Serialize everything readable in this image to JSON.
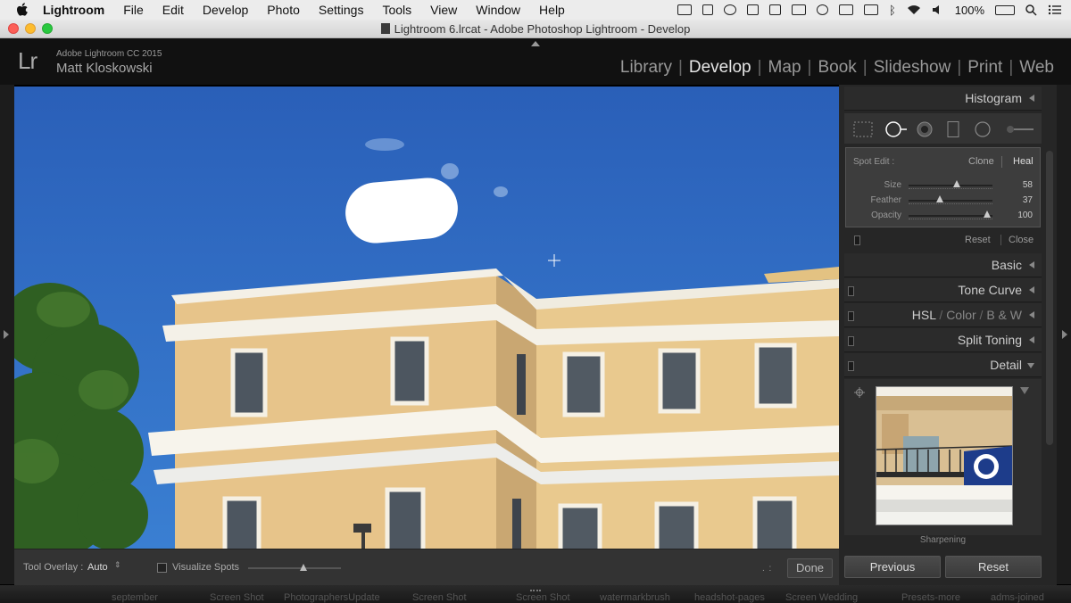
{
  "menubar": {
    "app": "Lightroom",
    "items": [
      "File",
      "Edit",
      "Develop",
      "Photo",
      "Settings",
      "Tools",
      "View",
      "Window",
      "Help"
    ],
    "battery": "100%"
  },
  "window": {
    "title": "Lightroom 6.lrcat - Adobe Photoshop Lightroom - Develop"
  },
  "identity": {
    "logo": "Lr",
    "product": "Adobe Lightroom CC 2015",
    "user": "Matt Kloskowski"
  },
  "modules": [
    "Library",
    "Develop",
    "Map",
    "Book",
    "Slideshow",
    "Print",
    "Web"
  ],
  "active_module": "Develop",
  "toolbar": {
    "overlay_label": "Tool Overlay :",
    "overlay_value": "Auto",
    "visualize_label": "Visualize Spots",
    "visualize_slider": 0.6,
    "done_label": "Done"
  },
  "right_panel": {
    "histogram": "Histogram",
    "spot": {
      "label": "Spot Edit :",
      "clone": "Clone",
      "heal": "Heal",
      "size_label": "Size",
      "size_value": "58",
      "size_pos": 0.57,
      "feather_label": "Feather",
      "feather_value": "37",
      "feather_pos": 0.37,
      "opacity_label": "Opacity",
      "opacity_value": "100",
      "opacity_pos": 0.94
    },
    "reset": "Reset",
    "close": "Close",
    "panels": {
      "basic": "Basic",
      "tone_curve": "Tone Curve",
      "hsl": "HSL",
      "color": "Color",
      "bw": "B & W",
      "split_toning": "Split Toning",
      "detail": "Detail"
    },
    "sharpening": "Sharpening",
    "previous_button": "Previous",
    "reset_button": "Reset"
  },
  "dock": [
    "september",
    "Screen Shot",
    "PhotographersUpdate",
    "Screen Shot",
    "Screen Shot",
    "watermarkbrush",
    "headshot-pages",
    "Screen Wedding",
    "Presets-more",
    "adms-joined"
  ],
  "colors": {
    "sky": "#2f6bc3",
    "building": "#e7c48a",
    "accent_active": "#e6e6e6",
    "panel_bg": "#262626"
  }
}
